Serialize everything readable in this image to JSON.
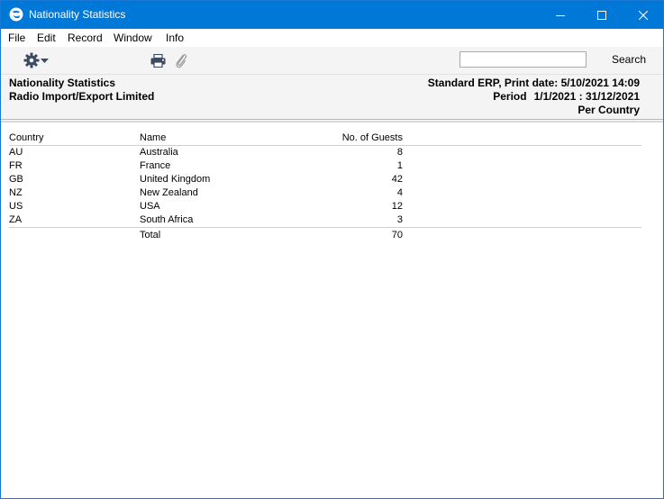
{
  "window": {
    "title": "Nationality Statistics"
  },
  "menu": [
    "File",
    "Edit",
    "Record",
    "Window",
    "Info"
  ],
  "toolbar": {
    "search_value": "",
    "search_label": "Search"
  },
  "report": {
    "title": "Nationality Statistics",
    "company": "Radio Import/Export Limited",
    "print_info": "Standard ERP, Print date: 5/10/2021 14:09",
    "period_label": "Period",
    "period_value": "1/1/2021 : 31/12/2021",
    "grouping": "Per Country"
  },
  "table": {
    "headers": {
      "country": "Country",
      "name": "Name",
      "guests": "No. of Guests"
    },
    "rows": [
      {
        "country": "AU",
        "name": "Australia",
        "guests": "8"
      },
      {
        "country": "FR",
        "name": "France",
        "guests": "1"
      },
      {
        "country": "GB",
        "name": "United Kingdom",
        "guests": "42"
      },
      {
        "country": "NZ",
        "name": "New Zealand",
        "guests": "4"
      },
      {
        "country": "US",
        "name": "USA",
        "guests": "12"
      },
      {
        "country": "ZA",
        "name": "South Africa",
        "guests": "3"
      }
    ],
    "total": {
      "label": "Total",
      "value": "70"
    }
  }
}
